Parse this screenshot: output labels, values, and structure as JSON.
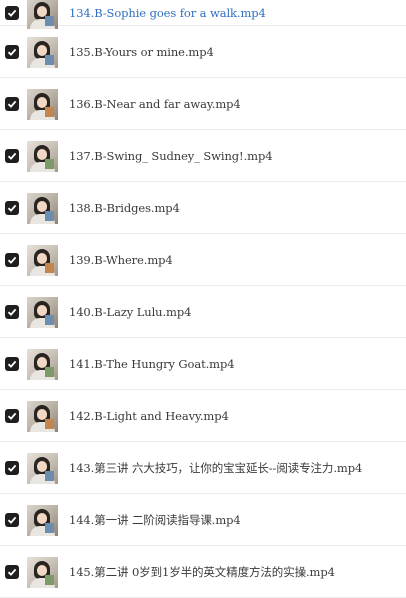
{
  "files": [
    {
      "title": "134.B-Sophie goes for a walk.mp4",
      "checked": true,
      "active": true
    },
    {
      "title": "135.B-Yours or mine.mp4",
      "checked": true
    },
    {
      "title": "136.B-Near and far away.mp4",
      "checked": true
    },
    {
      "title": "137.B-Swing_ Sudney_ Swing!.mp4",
      "checked": true
    },
    {
      "title": "138.B-Bridges.mp4",
      "checked": true
    },
    {
      "title": "139.B-Where.mp4",
      "checked": true
    },
    {
      "title": "140.B-Lazy Lulu.mp4",
      "checked": true
    },
    {
      "title": "141.B-The Hungry Goat.mp4",
      "checked": true
    },
    {
      "title": "142.B-Light and Heavy.mp4",
      "checked": true
    },
    {
      "title": "143.第三讲 六大技巧，让你的宝宝延长--阅读专注力.mp4",
      "checked": true
    },
    {
      "title": "144.第一讲 二阶阅读指导课.mp4",
      "checked": true
    },
    {
      "title": "145.第二讲 0岁到1岁半的英文精度方法的实操.mp4",
      "checked": true
    }
  ],
  "colors": {
    "active_title": "#2f6fc0",
    "title": "#3a3a3a",
    "checkbox": "#1f1f1f"
  },
  "icons": {
    "checkbox": "checkmark-icon",
    "thumbnail": "video-thumbnail"
  }
}
